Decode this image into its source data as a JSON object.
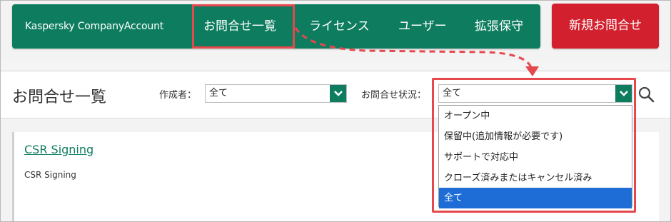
{
  "header": {
    "brand": "Kaspersky CompanyAccount",
    "nav": [
      {
        "label": "お問合せ一覧"
      },
      {
        "label": "ライセンス"
      },
      {
        "label": "ユーザー"
      },
      {
        "label": "拡張保守"
      }
    ],
    "new_inquiry_label": "新規お問合せ"
  },
  "filter": {
    "title": "お問合せ一覧",
    "creator_label": "作成者：",
    "creator_value": "全て",
    "status_label": "お問合せ状況：",
    "status_value": "全て"
  },
  "dropdown": {
    "options": [
      {
        "label": "オープン中"
      },
      {
        "label": "保留中(追加情報が必要です)"
      },
      {
        "label": "サポートで対応中"
      },
      {
        "label": "クローズ済みまたはキャンセル済み"
      },
      {
        "label": "全て",
        "selected": true
      }
    ]
  },
  "list": {
    "items": [
      {
        "title": "CSR Signing",
        "subtitle": "CSR Signing"
      }
    ]
  },
  "colors": {
    "brand_green": "#0e7d5f",
    "danger_red": "#d2202e",
    "annotation_red": "#e5484d",
    "selected_blue": "#1e6dd6"
  },
  "icons": {
    "dropdown": "chevron-down-icon",
    "search": "search-icon"
  }
}
